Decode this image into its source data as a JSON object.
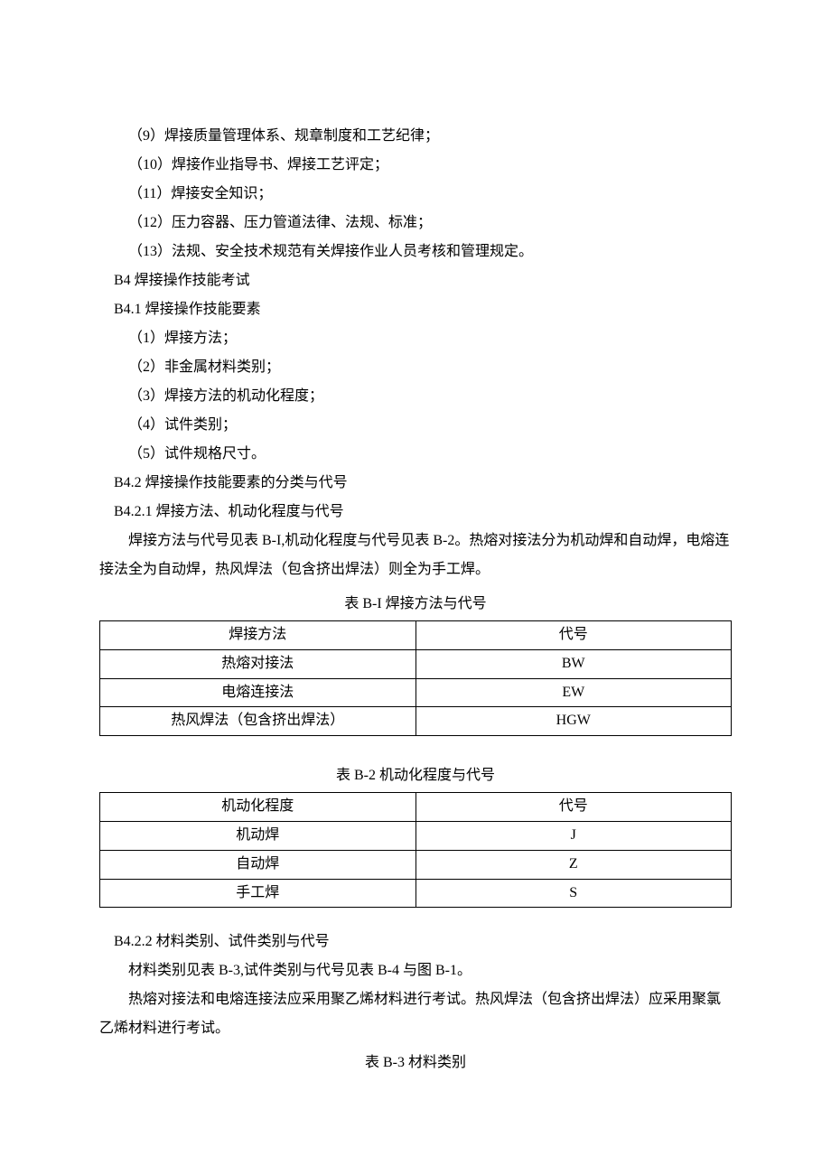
{
  "items": {
    "i9": "（9）焊接质量管理体系、规章制度和工艺纪律；",
    "i10": "（10）焊接作业指导书、焊接工艺评定；",
    "i11": "（11）焊接安全知识；",
    "i12": "（12）压力容器、压力管道法律、法规、标准；",
    "i13": "（13）法规、安全技术规范有关焊接作业人员考核和管理规定。"
  },
  "headings": {
    "b4": "B4 焊接操作技能考试",
    "b41": "B4.1 焊接操作技能要素",
    "b42": "B4.2 焊接操作技能要素的分类与代号",
    "b421": "B4.2.1 焊接方法、机动化程度与代号",
    "b422": "B4.2.2 材料类别、试件类别与代号"
  },
  "sub": {
    "s1": "（1）焊接方法；",
    "s2": "（2）非金属材料类别；",
    "s3": "（3）焊接方法的机动化程度；",
    "s4": "（4）试件类别；",
    "s5": "（5）试件规格尺寸。"
  },
  "para": {
    "p1": "焊接方法与代号见表 B-I,机动化程度与代号见表 B-2。热熔对接法分为机动焊和自动焊，电熔连接法全为自动焊，热风焊法（包含挤出焊法）则全为手工焊。",
    "p2": "材料类别见表 B-3,试件类别与代号见表 B-4 与图 B-1。",
    "p3": "热熔对接法和电熔连接法应采用聚乙烯材料进行考试。热风焊法（包含挤出焊法）应采用聚氯乙烯材料进行考试。"
  },
  "captions": {
    "t1": "表 B-I 焊接方法与代号",
    "t2": "表 B-2 机动化程度与代号",
    "t3": "表 B-3 材料类别"
  },
  "table1": {
    "h1": "焊接方法",
    "h2": "代号",
    "r1c1": "热熔对接法",
    "r1c2": "BW",
    "r2c1": "电熔连接法",
    "r2c2": "EW",
    "r3c1": "热风焊法（包含挤出焊法）",
    "r3c2": "HGW"
  },
  "table2": {
    "h1": "机动化程度",
    "h2": "代号",
    "r1c1": "机动焊",
    "r1c2": "J",
    "r2c1": "自动焊",
    "r2c2": "Z",
    "r3c1": "手工焊",
    "r3c2": "S"
  }
}
